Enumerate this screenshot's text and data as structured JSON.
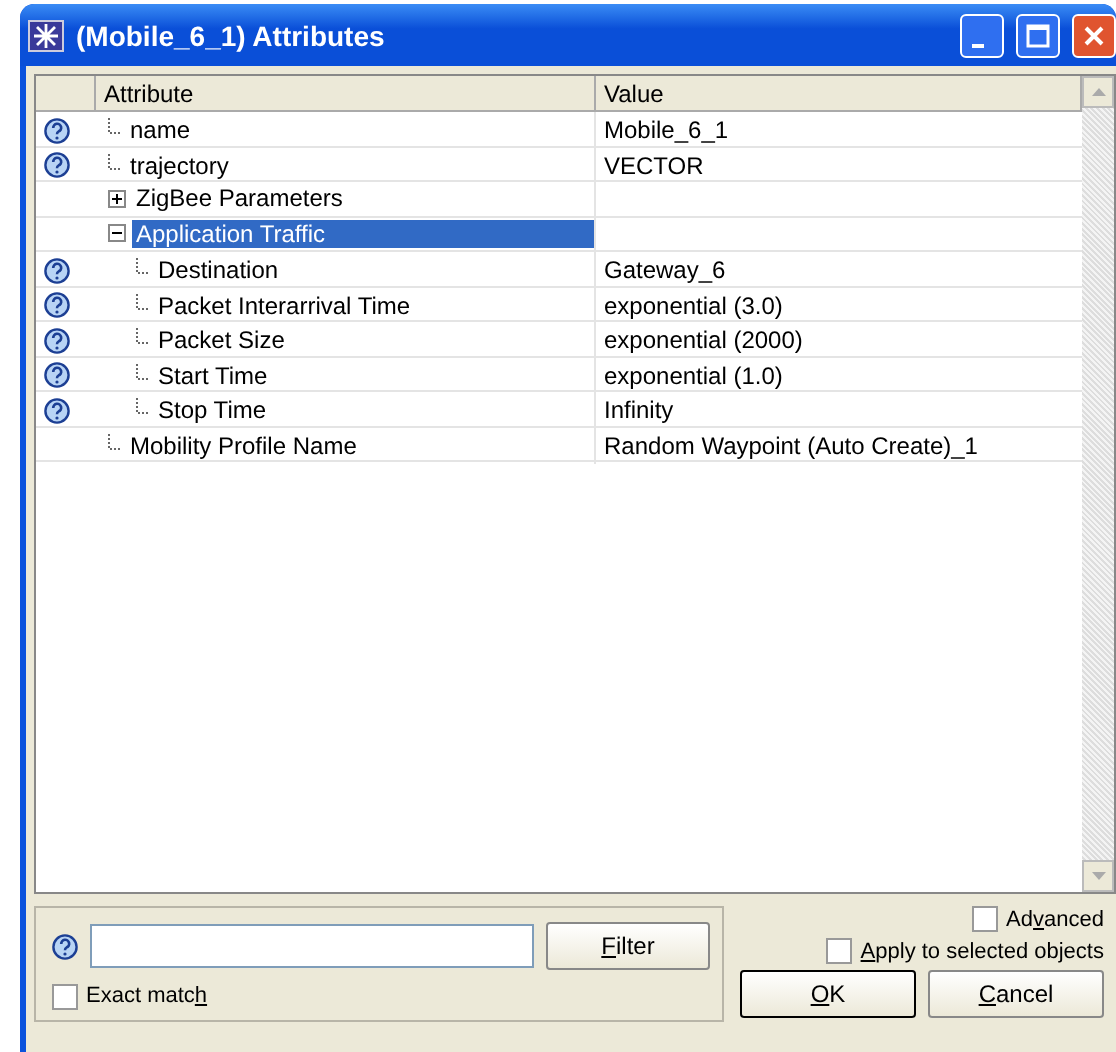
{
  "window": {
    "title": "(Mobile_6_1) Attributes"
  },
  "table": {
    "columns": [
      "Attribute",
      "Value"
    ],
    "rows": [
      {
        "label": "name",
        "value": "Mobile_6_1",
        "help": true
      },
      {
        "label": "trajectory",
        "value": "VECTOR",
        "help": true
      },
      {
        "label": "ZigBee Parameters",
        "expanded": false,
        "selected": false
      },
      {
        "label": "Application Traffic",
        "expanded": true,
        "selected": true,
        "children": [
          {
            "label": "Destination",
            "value": "Gateway_6",
            "help": true
          },
          {
            "label": "Packet Interarrival Time",
            "value": "exponential (3.0)",
            "help": true
          },
          {
            "label": "Packet Size",
            "value": "exponential (2000)",
            "help": true
          },
          {
            "label": "Start Time",
            "value": "exponential (1.0)",
            "help": true
          },
          {
            "label": "Stop Time",
            "value": "Infinity",
            "help": true
          }
        ]
      },
      {
        "label": "Mobility Profile Name",
        "value": "Random Waypoint (Auto Create)_1",
        "help": false
      }
    ]
  },
  "filter": {
    "button": {
      "key": "F",
      "post": "ilter"
    },
    "exact_match": {
      "label": {
        "pre": "Exact matc",
        "key": "h"
      },
      "checked": false
    }
  },
  "advanced": {
    "label": {
      "pre": "Ad",
      "key": "v",
      "post": "anced"
    },
    "checked": false
  },
  "apply_to_selected": {
    "label": {
      "key": "A",
      "post": "pply to selected objects"
    },
    "checked": false
  },
  "buttons": [
    {
      "key": "O",
      "post": "K"
    },
    {
      "key": "C",
      "post": "ancel"
    }
  ]
}
